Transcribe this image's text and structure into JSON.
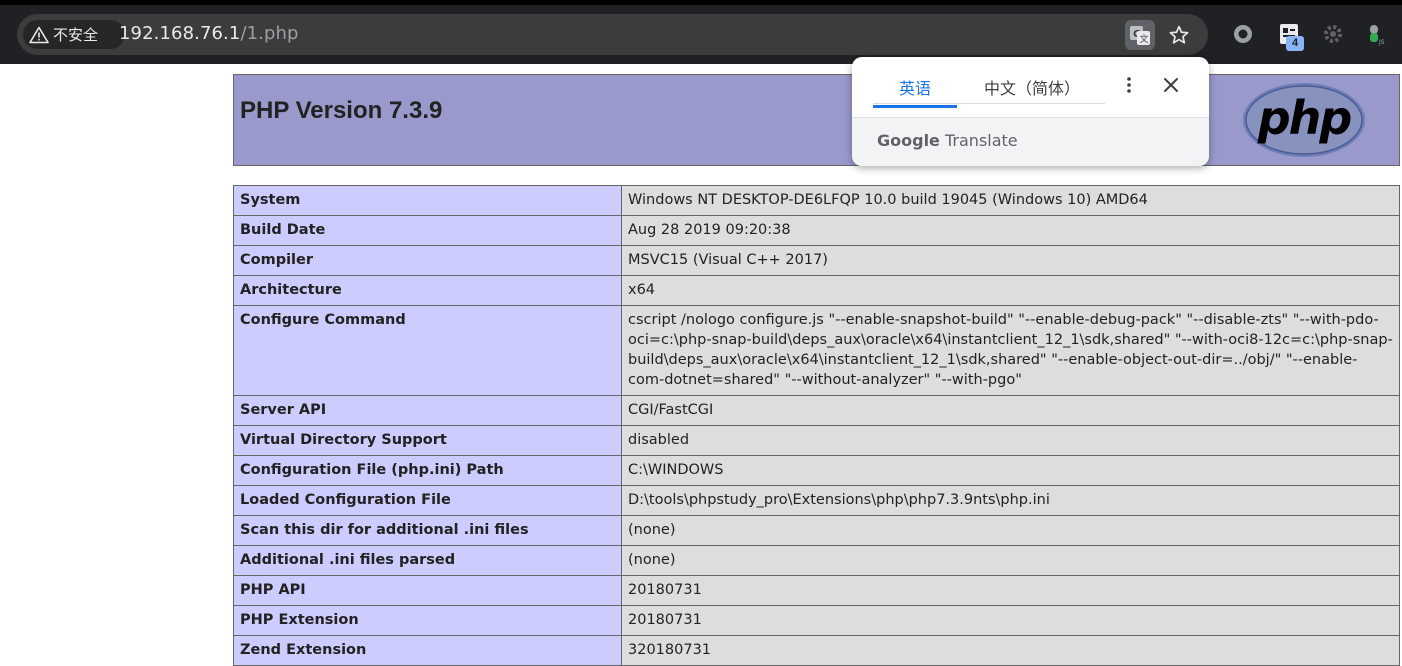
{
  "browser": {
    "security_label": "不安全",
    "url_host": "192.168.76.1",
    "url_path": "/1.php",
    "extension_badge": "4",
    "icons": [
      "warning-icon",
      "translate-icon",
      "star-icon",
      "circle-extension-icon",
      "notes-extension-icon",
      "gear-extension-icon",
      "bulb-extension-icon"
    ]
  },
  "translate_popup": {
    "tabs": [
      {
        "label": "英语",
        "active": true
      },
      {
        "label": "中文（简体）",
        "active": false
      }
    ],
    "brand_google": "Google",
    "brand_translate": "Translate",
    "accent_color": "#1a73e8"
  },
  "page": {
    "title": "PHP Version 7.3.9",
    "header_color": "#9999cc",
    "label_color": "#ccccff",
    "value_color": "#dddddd",
    "rows": [
      {
        "label": "System",
        "value": "Windows NT DESKTOP-DE6LFQP 10.0 build 19045 (Windows 10) AMD64"
      },
      {
        "label": "Build Date",
        "value": "Aug 28 2019 09:20:38"
      },
      {
        "label": "Compiler",
        "value": "MSVC15 (Visual C++ 2017)"
      },
      {
        "label": "Architecture",
        "value": "x64"
      },
      {
        "label": "Configure Command",
        "value": "cscript /nologo configure.js \"--enable-snapshot-build\" \"--enable-debug-pack\" \"--disable-zts\" \"--with-pdo-oci=c:\\php-snap-build\\deps_aux\\oracle\\x64\\instantclient_12_1\\sdk,shared\" \"--with-oci8-12c=c:\\php-snap-build\\deps_aux\\oracle\\x64\\instantclient_12_1\\sdk,shared\" \"--enable-object-out-dir=../obj/\" \"--enable-com-dotnet=shared\" \"--without-analyzer\" \"--with-pgo\""
      },
      {
        "label": "Server API",
        "value": "CGI/FastCGI"
      },
      {
        "label": "Virtual Directory Support",
        "value": "disabled"
      },
      {
        "label": "Configuration File (php.ini) Path",
        "value": "C:\\WINDOWS"
      },
      {
        "label": "Loaded Configuration File",
        "value": "D:\\tools\\phpstudy_pro\\Extensions\\php\\php7.3.9nts\\php.ini"
      },
      {
        "label": "Scan this dir for additional .ini files",
        "value": "(none)"
      },
      {
        "label": "Additional .ini files parsed",
        "value": "(none)"
      },
      {
        "label": "PHP API",
        "value": "20180731"
      },
      {
        "label": "PHP Extension",
        "value": "20180731"
      },
      {
        "label": "Zend Extension",
        "value": "320180731"
      }
    ]
  }
}
